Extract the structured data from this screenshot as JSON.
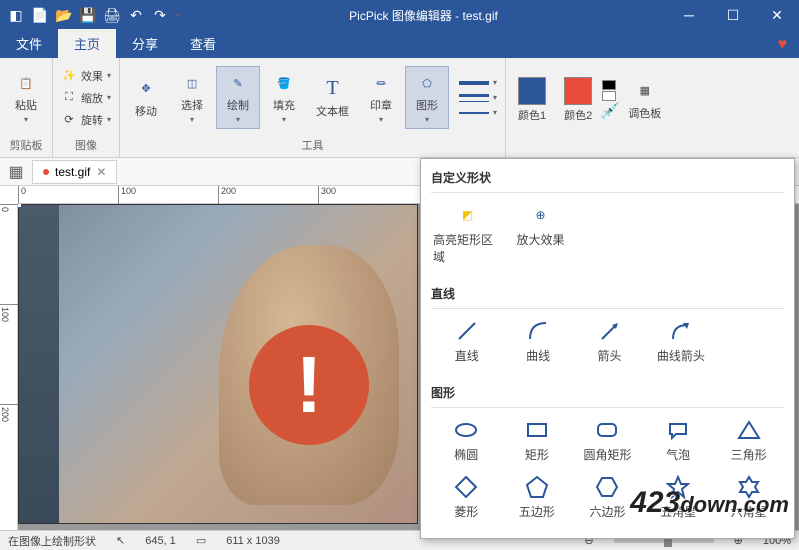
{
  "app": {
    "title": "PicPick 图像编辑器 - test.gif"
  },
  "qat": {
    "new": "新建",
    "open": "打开",
    "save": "保存",
    "print": "打印",
    "undo": "撤销",
    "redo": "重做"
  },
  "tabs": {
    "file": "文件",
    "home": "主页",
    "share": "分享",
    "view": "查看"
  },
  "ribbon": {
    "clipboard": {
      "paste": "粘贴",
      "label": "剪贴板"
    },
    "image": {
      "effects": "效果",
      "resize": "缩放",
      "rotate": "旋转",
      "label": "图像"
    },
    "tools": {
      "move": "移动",
      "select": "选择",
      "draw": "绘制",
      "fill": "填充",
      "text": "文本框",
      "stamp": "印章",
      "shapes": "图形",
      "label": "工具"
    },
    "colors": {
      "color1": "颜色1",
      "color2": "颜色2",
      "palette": "调色板",
      "color1_value": "#2b579a",
      "color2_value": "#e74c3c"
    }
  },
  "document": {
    "tab_name": "test.gif"
  },
  "ruler": {
    "h_ticks": [
      "0",
      "100",
      "200",
      "300"
    ],
    "v_ticks": [
      "0",
      "100",
      "200"
    ]
  },
  "shapes_panel": {
    "custom": {
      "header": "自定义形状",
      "highlight_rect": "高亮矩形区域",
      "magnify": "放大效果"
    },
    "lines": {
      "header": "直线",
      "line": "直线",
      "curve": "曲线",
      "arrow": "箭头",
      "curve_arrow": "曲线箭头"
    },
    "shapes": {
      "header": "图形",
      "ellipse": "椭圆",
      "rect": "矩形",
      "rounded_rect": "圆角矩形",
      "speech": "气泡",
      "triangle": "三角形",
      "diamond": "菱形",
      "pentagon": "五边形",
      "hexagon": "六边形",
      "star5": "五角星",
      "star6": "六角星"
    }
  },
  "statusbar": {
    "hint": "在图像上绘制形状",
    "cursor_pos": "645, 1",
    "canvas_size": "611 x 1039",
    "zoom": "100%"
  },
  "watermark": {
    "num": "423",
    "text": "down.com"
  }
}
